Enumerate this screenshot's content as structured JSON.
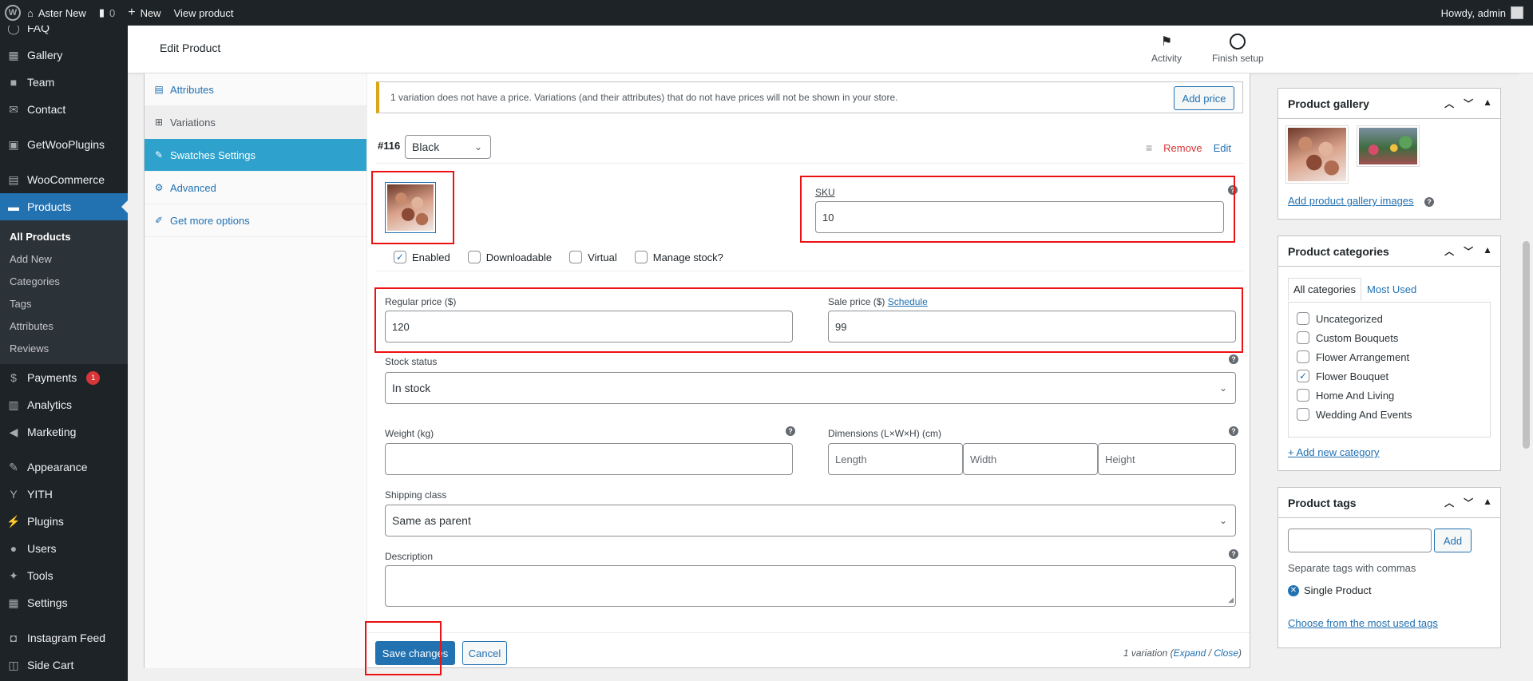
{
  "adminbar": {
    "site_name": "Aster New",
    "comments_count": "0",
    "new_label": "New",
    "view_product": "View product",
    "howdy": "Howdy, admin"
  },
  "sidebar": {
    "items": [
      {
        "label": "FAQ",
        "icon": "faq-icon"
      },
      {
        "label": "Gallery",
        "icon": "gallery-icon"
      },
      {
        "label": "Team",
        "icon": "team-icon"
      },
      {
        "label": "Contact",
        "icon": "mail-icon"
      },
      {
        "label": "GetWooPlugins",
        "icon": "plugin-grid-icon"
      },
      {
        "label": "WooCommerce",
        "icon": "woocommerce-icon"
      },
      {
        "label": "Products",
        "icon": "products-icon"
      },
      {
        "label": "Payments",
        "icon": "payments-icon",
        "badge": "1"
      },
      {
        "label": "Analytics",
        "icon": "analytics-icon"
      },
      {
        "label": "Marketing",
        "icon": "marketing-icon"
      },
      {
        "label": "Appearance",
        "icon": "appearance-icon"
      },
      {
        "label": "YITH",
        "icon": "yith-icon"
      },
      {
        "label": "Plugins",
        "icon": "plugins-icon"
      },
      {
        "label": "Users",
        "icon": "users-icon"
      },
      {
        "label": "Tools",
        "icon": "tools-icon"
      },
      {
        "label": "Settings",
        "icon": "settings-icon"
      },
      {
        "label": "Instagram Feed",
        "icon": "instagram-icon"
      },
      {
        "label": "Side Cart",
        "icon": "cart-icon"
      }
    ],
    "submenu": [
      "All Products",
      "Add New",
      "Categories",
      "Tags",
      "Attributes",
      "Reviews"
    ]
  },
  "header": {
    "title": "Edit Product",
    "activity": "Activity",
    "finish_setup": "Finish setup"
  },
  "tabs": [
    "Attributes",
    "Variations",
    "Swatches Settings",
    "Advanced",
    "Get more options"
  ],
  "notice": {
    "text": "1 variation does not have a price. Variations (and their attributes) that do not have prices will not be shown in your store.",
    "button": "Add price"
  },
  "variation": {
    "id": "#116",
    "color": "Black",
    "remove": "Remove",
    "edit": "Edit",
    "sku_label": "SKU",
    "sku_value": "10",
    "checks": {
      "enabled": {
        "label": "Enabled",
        "checked": true
      },
      "downloadable": {
        "label": "Downloadable",
        "checked": false
      },
      "virtual": {
        "label": "Virtual",
        "checked": false
      },
      "manage_stock": {
        "label": "Manage stock?",
        "checked": false
      }
    },
    "regular_price_label": "Regular price ($)",
    "regular_price": "120",
    "sale_price_label": "Sale price ($)",
    "schedule": "Schedule",
    "sale_price": "99",
    "stock_status_label": "Stock status",
    "stock_status": "In stock",
    "weight_label": "Weight (kg)",
    "dimensions_label": "Dimensions (L×W×H) (cm)",
    "length_ph": "Length",
    "width_ph": "Width",
    "height_ph": "Height",
    "shipping_label": "Shipping class",
    "shipping_value": "Same as parent",
    "description_label": "Description"
  },
  "footer": {
    "save": "Save changes",
    "cancel": "Cancel",
    "count": "1 variation",
    "expand": "Expand",
    "close": "Close"
  },
  "product_gallery": {
    "title": "Product gallery",
    "add_link": "Add product gallery images"
  },
  "product_categories": {
    "title": "Product categories",
    "tab_all": "All categories",
    "tab_used": "Most Used",
    "items": [
      {
        "label": "Uncategorized",
        "checked": false
      },
      {
        "label": "Custom Bouquets",
        "checked": false
      },
      {
        "label": "Flower Arrangement",
        "checked": false
      },
      {
        "label": "Flower Bouquet",
        "checked": true
      },
      {
        "label": "Home And Living",
        "checked": false
      },
      {
        "label": "Wedding And Events",
        "checked": false
      }
    ],
    "add_new": "+ Add new category"
  },
  "product_tags": {
    "title": "Product tags",
    "add": "Add",
    "hint": "Separate tags with commas",
    "tag": "Single Product",
    "choose": "Choose from the most used tags"
  }
}
